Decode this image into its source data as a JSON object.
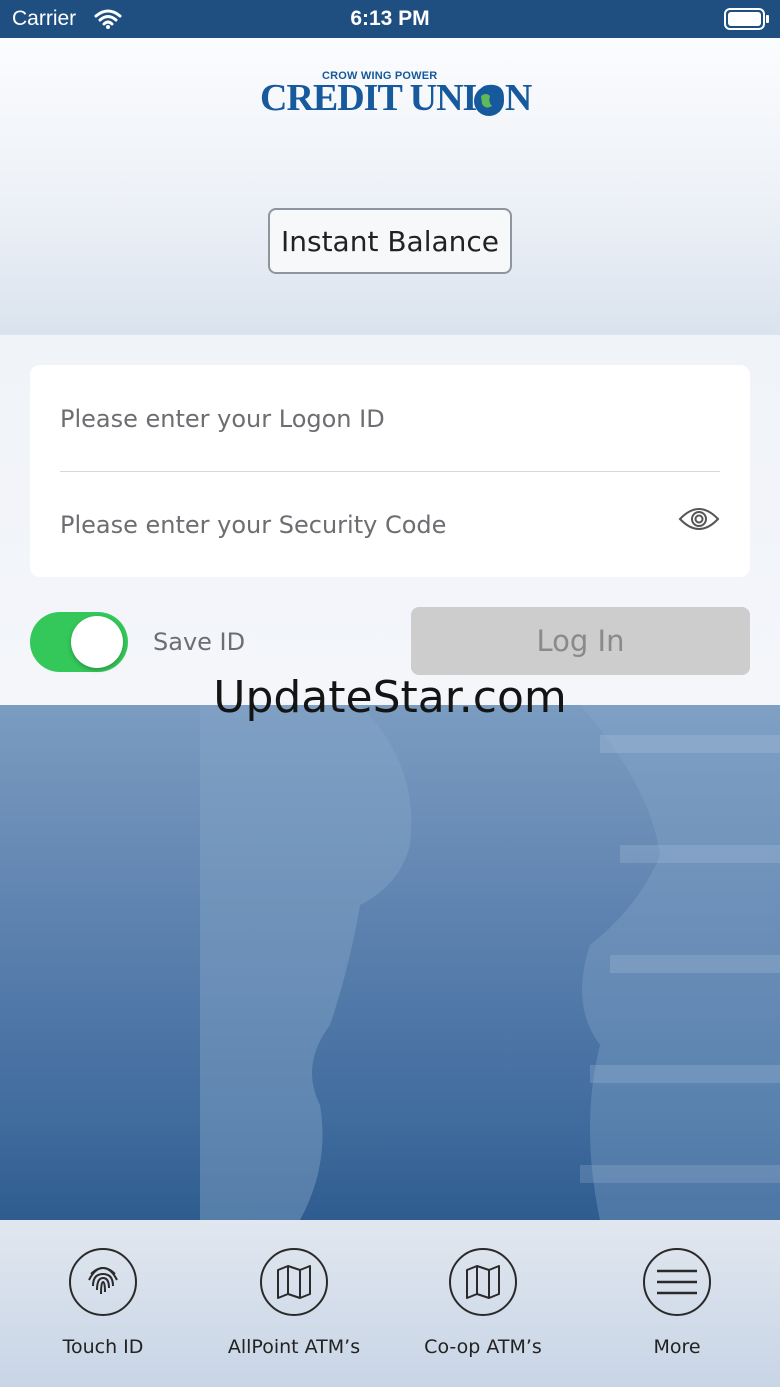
{
  "status_bar": {
    "carrier": "Carrier",
    "time": "6:13 PM"
  },
  "logo": {
    "tagline": "CROW WING POWER",
    "name": "CREDIT UNION"
  },
  "header": {
    "instant_balance_label": "Instant Balance"
  },
  "login_form": {
    "logon_placeholder": "Please enter your Logon ID",
    "security_placeholder": "Please enter your Security Code",
    "save_id_label": "Save ID",
    "save_id_on": true,
    "login_label": "Log In"
  },
  "watermark": "UpdateStar.com",
  "toolbar": {
    "items": [
      {
        "label": "Touch ID",
        "icon": "fingerprint-icon"
      },
      {
        "label": "AllPoint ATM’s",
        "icon": "map-icon"
      },
      {
        "label": "Co-op ATM’s",
        "icon": "map-icon"
      },
      {
        "label": "More",
        "icon": "menu-icon"
      }
    ]
  },
  "colors": {
    "status_bar": "#1f4f80",
    "brand_blue": "#16599c",
    "toggle_on": "#34c759"
  }
}
